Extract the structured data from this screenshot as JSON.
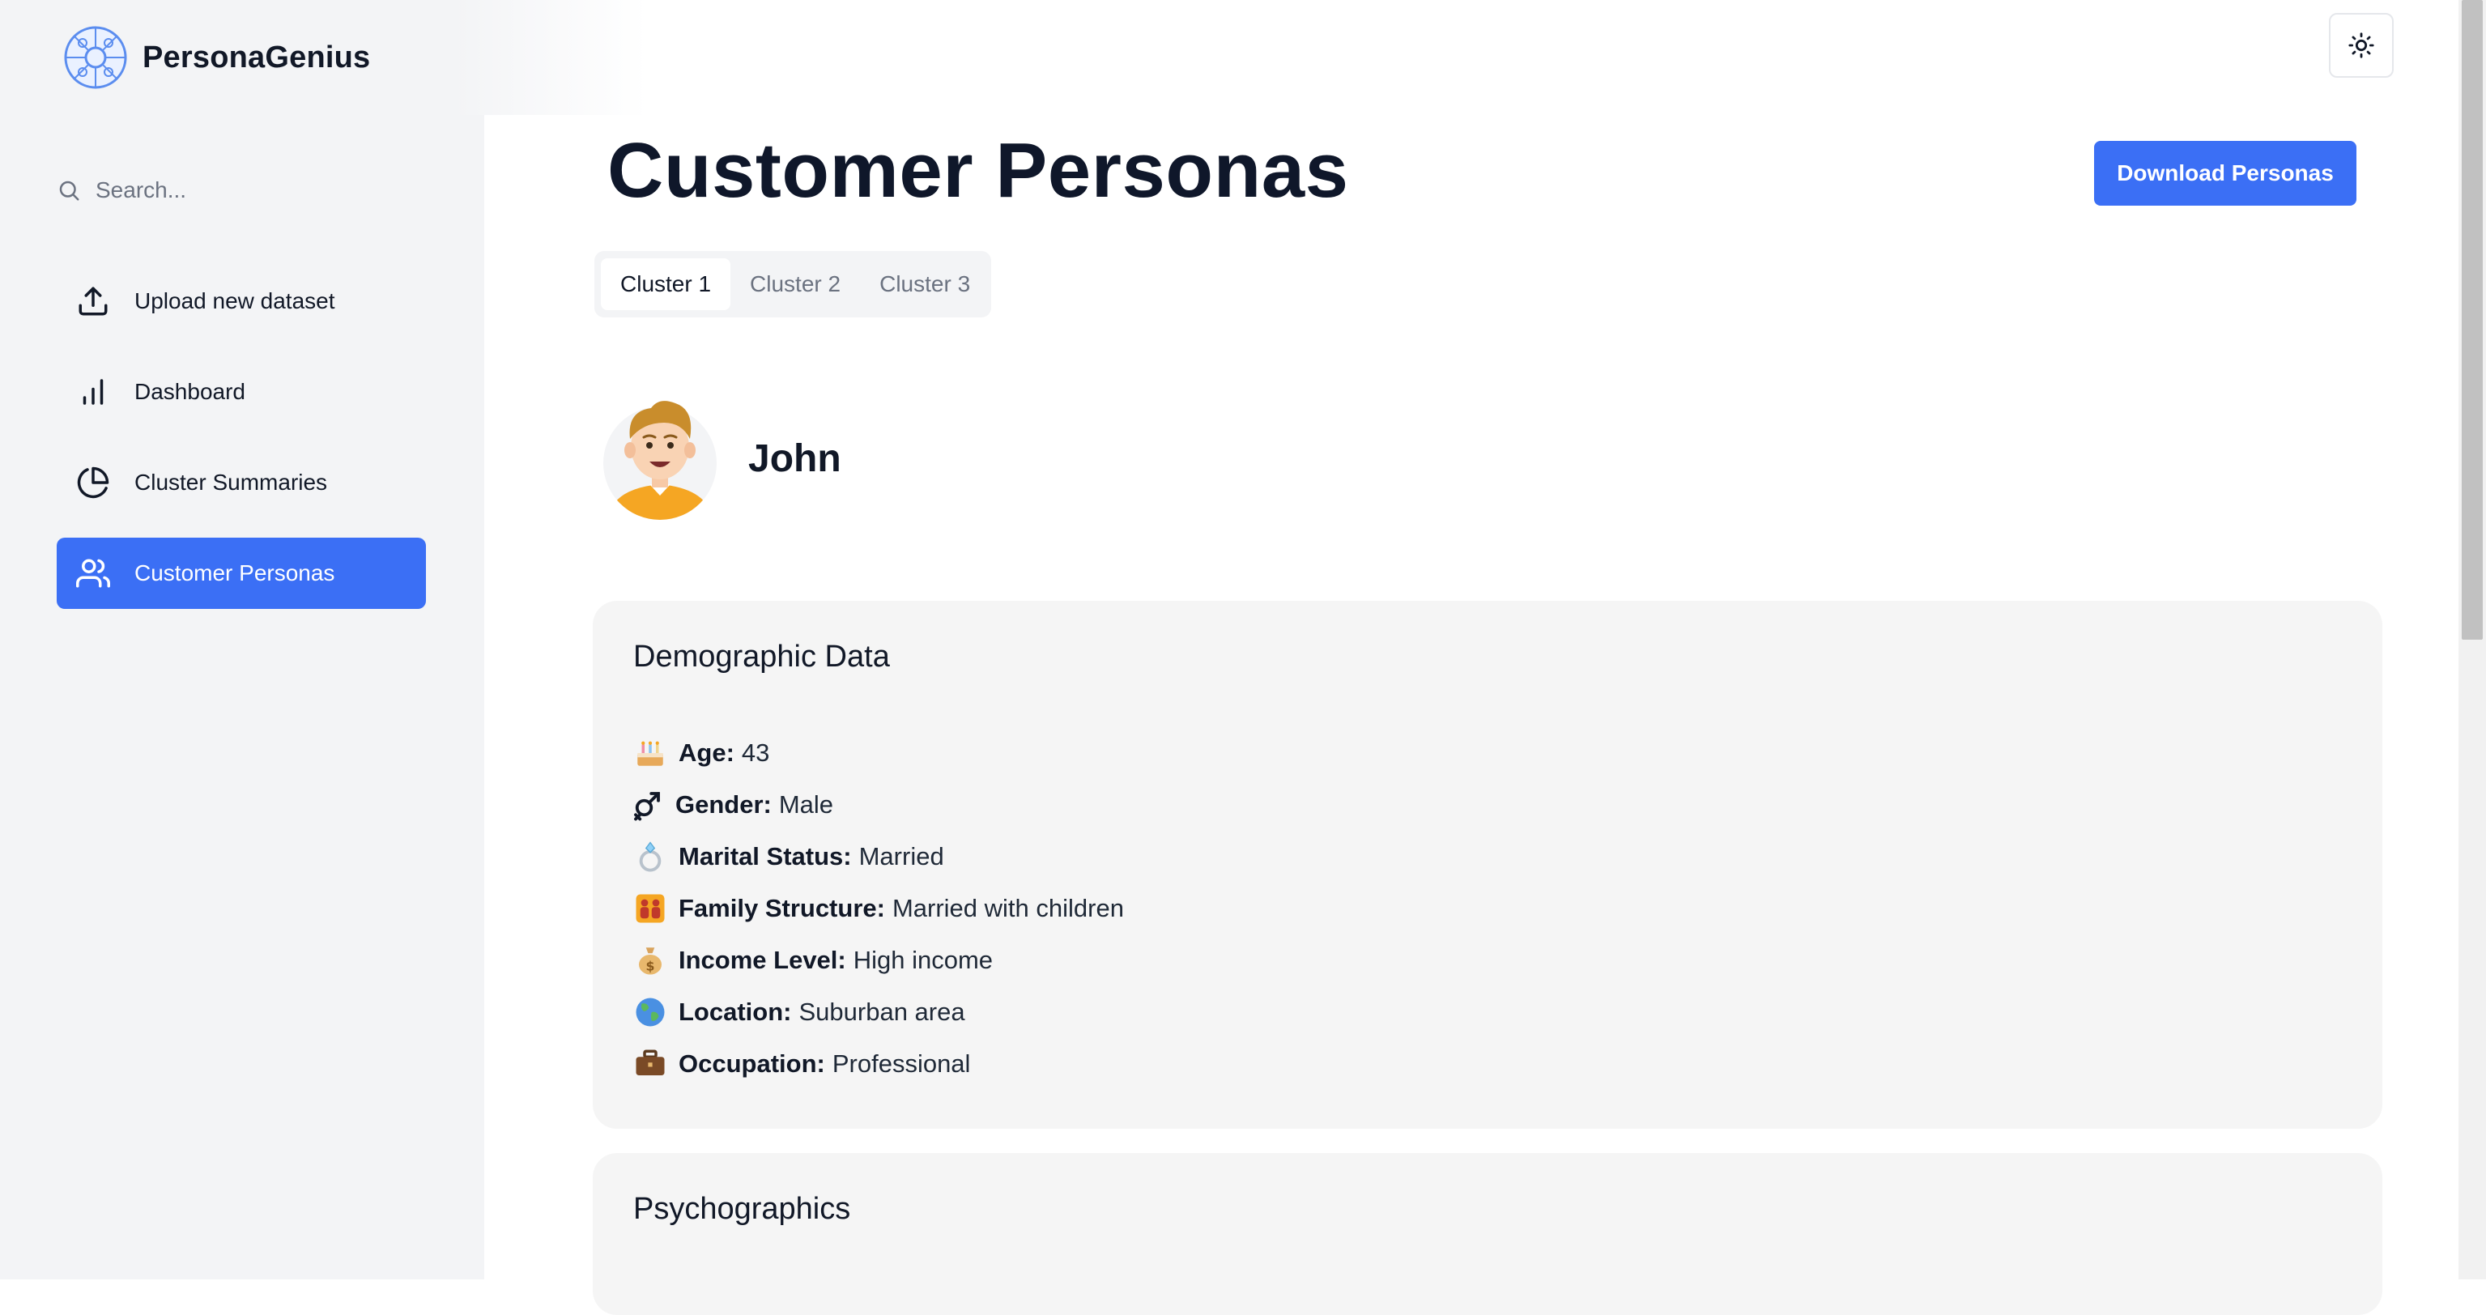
{
  "app": {
    "name": "PersonaGenius",
    "logo_icon": "persona-genius-logo"
  },
  "sidebar": {
    "search_placeholder": "Search...",
    "items": [
      {
        "label": "Upload new dataset",
        "icon": "upload-icon",
        "active": false
      },
      {
        "label": "Dashboard",
        "icon": "bar-chart-icon",
        "active": false
      },
      {
        "label": "Cluster Summaries",
        "icon": "pie-chart-icon",
        "active": false
      },
      {
        "label": "Customer Personas",
        "icon": "users-icon",
        "active": true
      }
    ]
  },
  "header": {
    "theme_toggle_icon": "sun-icon"
  },
  "main": {
    "title": "Customer Personas",
    "download_label": "Download Personas",
    "tabs": [
      {
        "label": "Cluster 1",
        "active": true
      },
      {
        "label": "Cluster 2",
        "active": false
      },
      {
        "label": "Cluster 3",
        "active": false
      }
    ],
    "persona": {
      "name": "John",
      "avatar_icon": "avatar-john"
    },
    "demographic": {
      "title": "Demographic Data",
      "items": [
        {
          "icon": "cake-icon",
          "label": "Age:",
          "value": "43"
        },
        {
          "icon": "gender-icon",
          "label": "Gender:",
          "value": "Male"
        },
        {
          "icon": "ring-icon",
          "label": "Marital Status:",
          "value": "Married"
        },
        {
          "icon": "family-icon",
          "label": "Family Structure:",
          "value": "Married with children"
        },
        {
          "icon": "money-bag-icon",
          "label": "Income Level:",
          "value": "High income"
        },
        {
          "icon": "globe-icon",
          "label": "Location:",
          "value": "Suburban area"
        },
        {
          "icon": "briefcase-icon",
          "label": "Occupation:",
          "value": "Professional"
        }
      ]
    },
    "psychographics": {
      "title": "Psychographics"
    }
  },
  "colors": {
    "accent": "#3b6ff5",
    "sidebar_bg": "#f3f4f6",
    "card_bg": "#f5f5f5"
  }
}
